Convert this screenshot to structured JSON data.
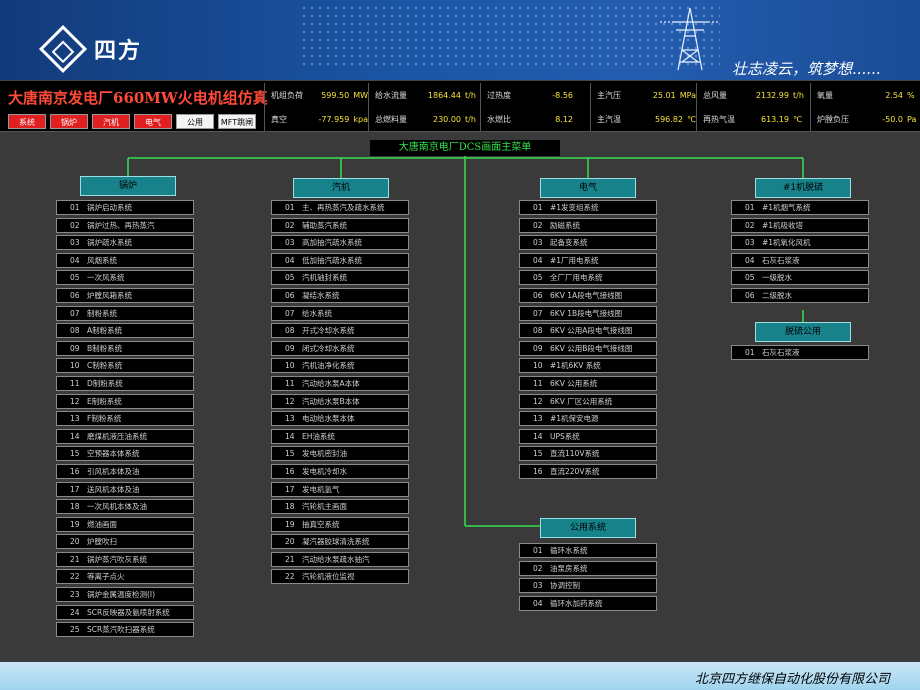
{
  "banner": {
    "logo_text": "四方",
    "slogan": "壮志凌云，筑梦想......"
  },
  "header": {
    "plant_title": "大唐南京发电厂660MW火电机组仿真",
    "nav": [
      {
        "label": "系统",
        "style": "red"
      },
      {
        "label": "锅炉",
        "style": "red"
      },
      {
        "label": "汽机",
        "style": "red"
      },
      {
        "label": "电气",
        "style": "red"
      },
      {
        "label": "公用",
        "style": "white"
      },
      {
        "label": "MFT跳闸",
        "style": "white"
      }
    ],
    "stats": [
      {
        "label": "机组负荷",
        "value": "599.50",
        "unit": "MW"
      },
      {
        "label": "给水流量",
        "value": "1864.44",
        "unit": "t/h"
      },
      {
        "label": "过热度",
        "value": "-8.56",
        "unit": ""
      },
      {
        "label": "主汽压",
        "value": "25.01",
        "unit": "MPa"
      },
      {
        "label": "总风量",
        "value": "2132.99",
        "unit": "t/h"
      },
      {
        "label": "氧量",
        "value": "2.54",
        "unit": "%"
      },
      {
        "label": "真空",
        "value": "-77.959",
        "unit": "kpa"
      },
      {
        "label": "总燃料量",
        "value": "230.00",
        "unit": "t/h"
      },
      {
        "label": "水燃比",
        "value": "8.12",
        "unit": ""
      },
      {
        "label": "主汽温",
        "value": "596.82",
        "unit": "℃"
      },
      {
        "label": "再热气温",
        "value": "613.19",
        "unit": "℃"
      },
      {
        "label": "炉膛负压",
        "value": "-50.0",
        "unit": "Pa"
      }
    ]
  },
  "main_menu_title": "大唐南京电厂DCS画面主菜单",
  "groups": {
    "boiler": {
      "title": "锅炉",
      "items": [
        {
          "num": "01",
          "label": "锅炉启动系统"
        },
        {
          "num": "02",
          "label": "锅炉过热、再热蒸汽"
        },
        {
          "num": "03",
          "label": "锅炉疏水系统"
        },
        {
          "num": "04",
          "label": "风烟系统"
        },
        {
          "num": "05",
          "label": "一次风系统"
        },
        {
          "num": "06",
          "label": "炉膛风箱系统"
        },
        {
          "num": "07",
          "label": "制粉系统"
        },
        {
          "num": "08",
          "label": "A制粉系统"
        },
        {
          "num": "09",
          "label": "B制粉系统"
        },
        {
          "num": "10",
          "label": "C制粉系统"
        },
        {
          "num": "11",
          "label": "D制粉系统"
        },
        {
          "num": "12",
          "label": "E制粉系统"
        },
        {
          "num": "13",
          "label": "F制粉系统"
        },
        {
          "num": "14",
          "label": "磨煤机液压油系统"
        },
        {
          "num": "15",
          "label": "空预器本体系统"
        },
        {
          "num": "16",
          "label": "引风机本体及油"
        },
        {
          "num": "17",
          "label": "送风机本体及油"
        },
        {
          "num": "18",
          "label": "一次风机本体及油"
        },
        {
          "num": "19",
          "label": "燃油画面"
        },
        {
          "num": "20",
          "label": "炉膛吹扫"
        },
        {
          "num": "21",
          "label": "锅炉蒸汽吹灰系统"
        },
        {
          "num": "22",
          "label": "等离子点火"
        },
        {
          "num": "23",
          "label": "锅炉金属温度检测(I)"
        },
        {
          "num": "24",
          "label": "SCR反映器及氨喷射系统"
        },
        {
          "num": "25",
          "label": "SCR蒸汽吹扫器系统"
        }
      ]
    },
    "turbine": {
      "title": "汽机",
      "items": [
        {
          "num": "01",
          "label": "主、再热蒸汽及疏水系统"
        },
        {
          "num": "02",
          "label": "辅助蒸汽系统"
        },
        {
          "num": "03",
          "label": "高加抽汽疏水系统"
        },
        {
          "num": "04",
          "label": "低加抽汽疏水系统"
        },
        {
          "num": "05",
          "label": "汽机轴封系统"
        },
        {
          "num": "06",
          "label": "凝结水系统"
        },
        {
          "num": "07",
          "label": "给水系统"
        },
        {
          "num": "08",
          "label": "开式冷却水系统"
        },
        {
          "num": "09",
          "label": "闭式冷却水系统"
        },
        {
          "num": "10",
          "label": "汽机油净化系统"
        },
        {
          "num": "11",
          "label": "汽动给水泵A本体"
        },
        {
          "num": "12",
          "label": "汽动给水泵B本体"
        },
        {
          "num": "13",
          "label": "电动给水泵本体"
        },
        {
          "num": "14",
          "label": "EH油系统"
        },
        {
          "num": "15",
          "label": "发电机密封油"
        },
        {
          "num": "16",
          "label": "发电机冷却水"
        },
        {
          "num": "17",
          "label": "发电机氢气"
        },
        {
          "num": "18",
          "label": "汽轮机主画面"
        },
        {
          "num": "19",
          "label": "抽真空系统"
        },
        {
          "num": "20",
          "label": "凝汽器胶球清洗系统"
        },
        {
          "num": "21",
          "label": "汽动给水泵疏水抽汽"
        },
        {
          "num": "22",
          "label": "汽轮机液位监视"
        }
      ]
    },
    "electrical": {
      "title": "电气",
      "items": [
        {
          "num": "01",
          "label": "#1发变组系统"
        },
        {
          "num": "02",
          "label": "励磁系统"
        },
        {
          "num": "03",
          "label": "起备变系统"
        },
        {
          "num": "04",
          "label": "#1厂用电系统"
        },
        {
          "num": "05",
          "label": "全厂厂用电系统"
        },
        {
          "num": "06",
          "label": "6KV 1A段电气接线图"
        },
        {
          "num": "07",
          "label": "6KV 1B段电气接线图"
        },
        {
          "num": "08",
          "label": "6KV 公用A段电气接线图"
        },
        {
          "num": "09",
          "label": "6KV 公用B段电气接线图"
        },
        {
          "num": "10",
          "label": "#1机6KV 系统"
        },
        {
          "num": "11",
          "label": "6KV 公用系统"
        },
        {
          "num": "12",
          "label": "6KV 厂区公用系统"
        },
        {
          "num": "13",
          "label": "#1机保安电源"
        },
        {
          "num": "14",
          "label": "UPS系统"
        },
        {
          "num": "15",
          "label": "直流110V系统"
        },
        {
          "num": "16",
          "label": "直流220V系统"
        }
      ]
    },
    "common": {
      "title": "公用系统",
      "items": [
        {
          "num": "01",
          "label": "循环水系统"
        },
        {
          "num": "02",
          "label": "油泵房系统"
        },
        {
          "num": "03",
          "label": "协调控制"
        },
        {
          "num": "04",
          "label": "循环水加药系统"
        }
      ]
    },
    "desulf": {
      "title": "#1机脱硫",
      "items": [
        {
          "num": "01",
          "label": "#1机烟气系统"
        },
        {
          "num": "02",
          "label": "#1机吸收塔"
        },
        {
          "num": "03",
          "label": "#1机氧化风机"
        },
        {
          "num": "04",
          "label": "石灰石浆液"
        },
        {
          "num": "05",
          "label": "一级脱水"
        },
        {
          "num": "06",
          "label": "二级脱水"
        }
      ]
    },
    "desulf_common": {
      "title": "脱硫公用",
      "items": [
        {
          "num": "01",
          "label": "石灰石浆液"
        }
      ]
    }
  },
  "footer": {
    "company": "北京四方继保自动化股份有限公司"
  }
}
